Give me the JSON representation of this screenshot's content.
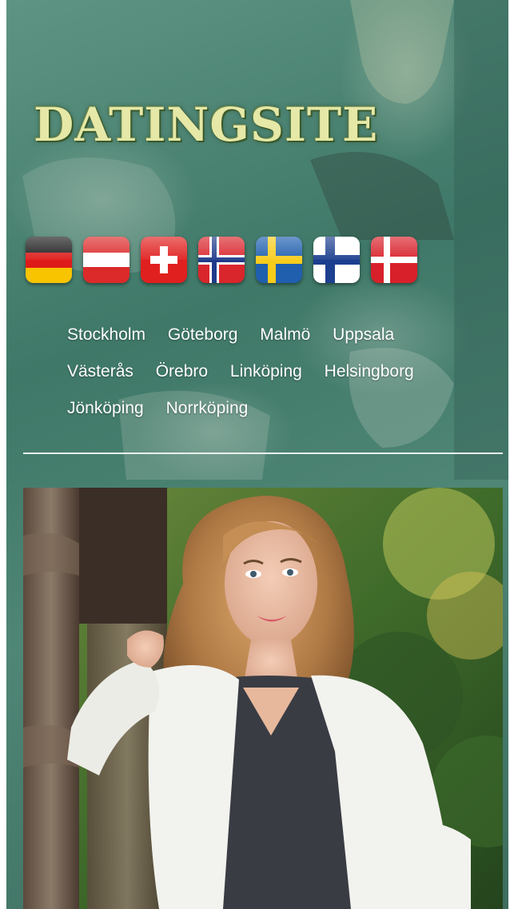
{
  "header": {
    "logo_text": "DATINGSITE"
  },
  "flags": [
    {
      "country": "Germany",
      "icon": "flag-germany-icon"
    },
    {
      "country": "Austria",
      "icon": "flag-austria-icon"
    },
    {
      "country": "Switzerland",
      "icon": "flag-switzerland-icon"
    },
    {
      "country": "Norway",
      "icon": "flag-norway-icon"
    },
    {
      "country": "Sweden",
      "icon": "flag-sweden-icon"
    },
    {
      "country": "Finland",
      "icon": "flag-finland-icon"
    },
    {
      "country": "Denmark",
      "icon": "flag-denmark-icon"
    }
  ],
  "cities": [
    "Stockholm",
    "Göteborg",
    "Malmö",
    "Uppsala",
    "Västerås",
    "Örebro",
    "Linköping",
    "Helsingborg",
    "Jönköping",
    "Norrköping"
  ],
  "colors": {
    "background_teal": "#3f7868",
    "logo_text": "#e5e8a6",
    "city_text": "#ffffff",
    "divider": "#e8f0ec"
  }
}
